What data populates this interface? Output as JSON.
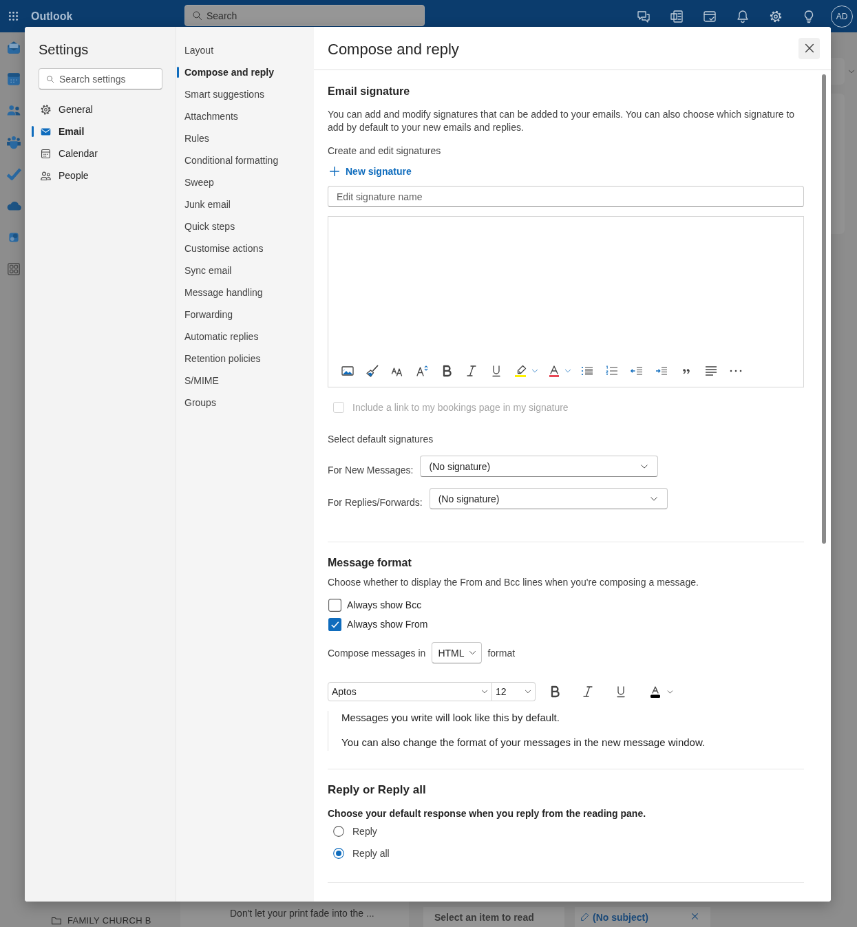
{
  "top_bar": {
    "app_name": "Outlook",
    "search": {
      "placeholder": "Search"
    },
    "avatar": "AD"
  },
  "background": {
    "folder": "FAMILY CHURCH B",
    "message_preview": "Don't let your print fade into the ...",
    "reading_pane": "Select an item to read",
    "draft_tab": "(No subject)"
  },
  "settings": {
    "title": "Settings",
    "search": {
      "placeholder": "Search settings"
    },
    "categories": [
      {
        "label": "General",
        "selected": false
      },
      {
        "label": "Email",
        "selected": true
      },
      {
        "label": "Calendar",
        "selected": false
      },
      {
        "label": "People",
        "selected": false
      }
    ],
    "subcategories": [
      {
        "label": "Layout",
        "selected": false
      },
      {
        "label": "Compose and reply",
        "selected": true
      },
      {
        "label": "Smart suggestions",
        "selected": false
      },
      {
        "label": "Attachments",
        "selected": false
      },
      {
        "label": "Rules",
        "selected": false
      },
      {
        "label": "Conditional formatting",
        "selected": false
      },
      {
        "label": "Sweep",
        "selected": false
      },
      {
        "label": "Junk email",
        "selected": false
      },
      {
        "label": "Quick steps",
        "selected": false
      },
      {
        "label": "Customise actions",
        "selected": false
      },
      {
        "label": "Sync email",
        "selected": false
      },
      {
        "label": "Message handling",
        "selected": false
      },
      {
        "label": "Forwarding",
        "selected": false
      },
      {
        "label": "Automatic replies",
        "selected": false
      },
      {
        "label": "Retention policies",
        "selected": false
      },
      {
        "label": "S/MIME",
        "selected": false
      },
      {
        "label": "Groups",
        "selected": false
      }
    ]
  },
  "page": {
    "title": "Compose and reply",
    "email_signature": {
      "heading": "Email signature",
      "description": "You can add and modify signatures that can be added to your emails. You can also choose which signature to add by default to your new emails and replies.",
      "create_label": "Create and edit signatures",
      "new_signature": "New signature",
      "name_field": {
        "placeholder": "Edit signature name"
      },
      "bookings_link": {
        "label": "Include a link to my bookings page in my signature",
        "checked": false,
        "disabled": true
      },
      "defaults_heading": "Select default signatures",
      "defaults": [
        {
          "label": "For New Messages:",
          "value": "(No signature)"
        },
        {
          "label": "For Replies/Forwards:",
          "value": "(No signature)"
        }
      ]
    },
    "message_format": {
      "heading": "Message format",
      "description": "Choose whether to display the From and Bcc lines when you're composing a message.",
      "options": [
        {
          "label": "Always show Bcc",
          "checked": false
        },
        {
          "label": "Always show From",
          "checked": true
        }
      ],
      "compose_prefix": "Compose messages in",
      "compose_format": "HTML",
      "compose_suffix": "format",
      "font": "Aptos",
      "font_size": "12",
      "preview": [
        "Messages you write will look like this by default.",
        "You can also change the format of your messages in the new message window."
      ]
    },
    "reply": {
      "heading": "Reply or Reply all",
      "description": "Choose your default response when you reply from the reading pane.",
      "options": [
        {
          "label": "Reply",
          "selected": false
        },
        {
          "label": "Reply all",
          "selected": true
        }
      ]
    }
  }
}
